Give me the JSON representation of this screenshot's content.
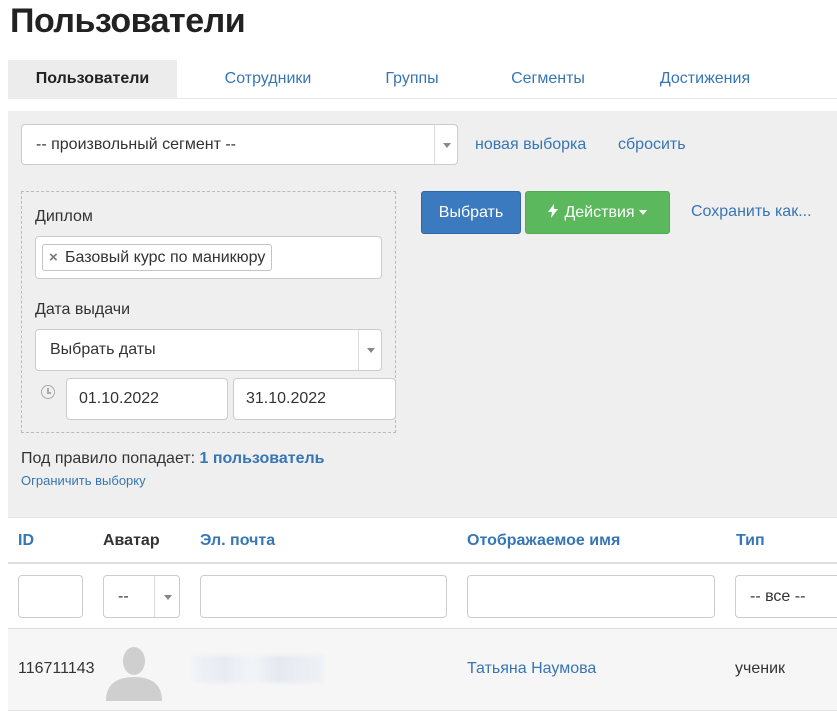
{
  "page": {
    "title": "Пользователи"
  },
  "tabs": [
    {
      "label": "Пользователи",
      "active": true
    },
    {
      "label": "Сотрудники",
      "active": false
    },
    {
      "label": "Группы",
      "active": false
    },
    {
      "label": "Сегменты",
      "active": false
    },
    {
      "label": "Достижения",
      "active": false
    }
  ],
  "filter": {
    "segment_value": "-- произвольный сегмент --",
    "new_selection_link": "новая выборка",
    "reset_link": "сбросить",
    "diploma_label": "Диплом",
    "diploma_tag": "Базовый курс по маникюру",
    "issue_date_label": "Дата выдачи",
    "date_mode_value": "Выбрать даты",
    "date_from": "01.10.2022",
    "date_to": "31.10.2022",
    "select_button": "Выбрать",
    "actions_button": "Действия",
    "save_as_link": "Сохранить как...",
    "rule_count_prefix": "Под правило попадает:",
    "rule_count_link": "1 пользователь",
    "limit_link": "Ограничить выборку"
  },
  "table": {
    "columns": [
      {
        "label": "ID",
        "sortable": true
      },
      {
        "label": "Аватар",
        "sortable": false
      },
      {
        "label": "Эл. почта",
        "sortable": true
      },
      {
        "label": "Отображаемое имя",
        "sortable": true
      },
      {
        "label": "Тип",
        "sortable": true
      }
    ],
    "filters": {
      "avatar_value": "--",
      "type_value": "-- все --"
    },
    "rows": [
      {
        "id": "116711143",
        "display_name": "Татьяна Наумова",
        "type": "ученик"
      }
    ]
  },
  "colors": {
    "link": "#3776b4",
    "primary": "#3c7abf",
    "success": "#5cb85c",
    "panel": "#efefef"
  }
}
